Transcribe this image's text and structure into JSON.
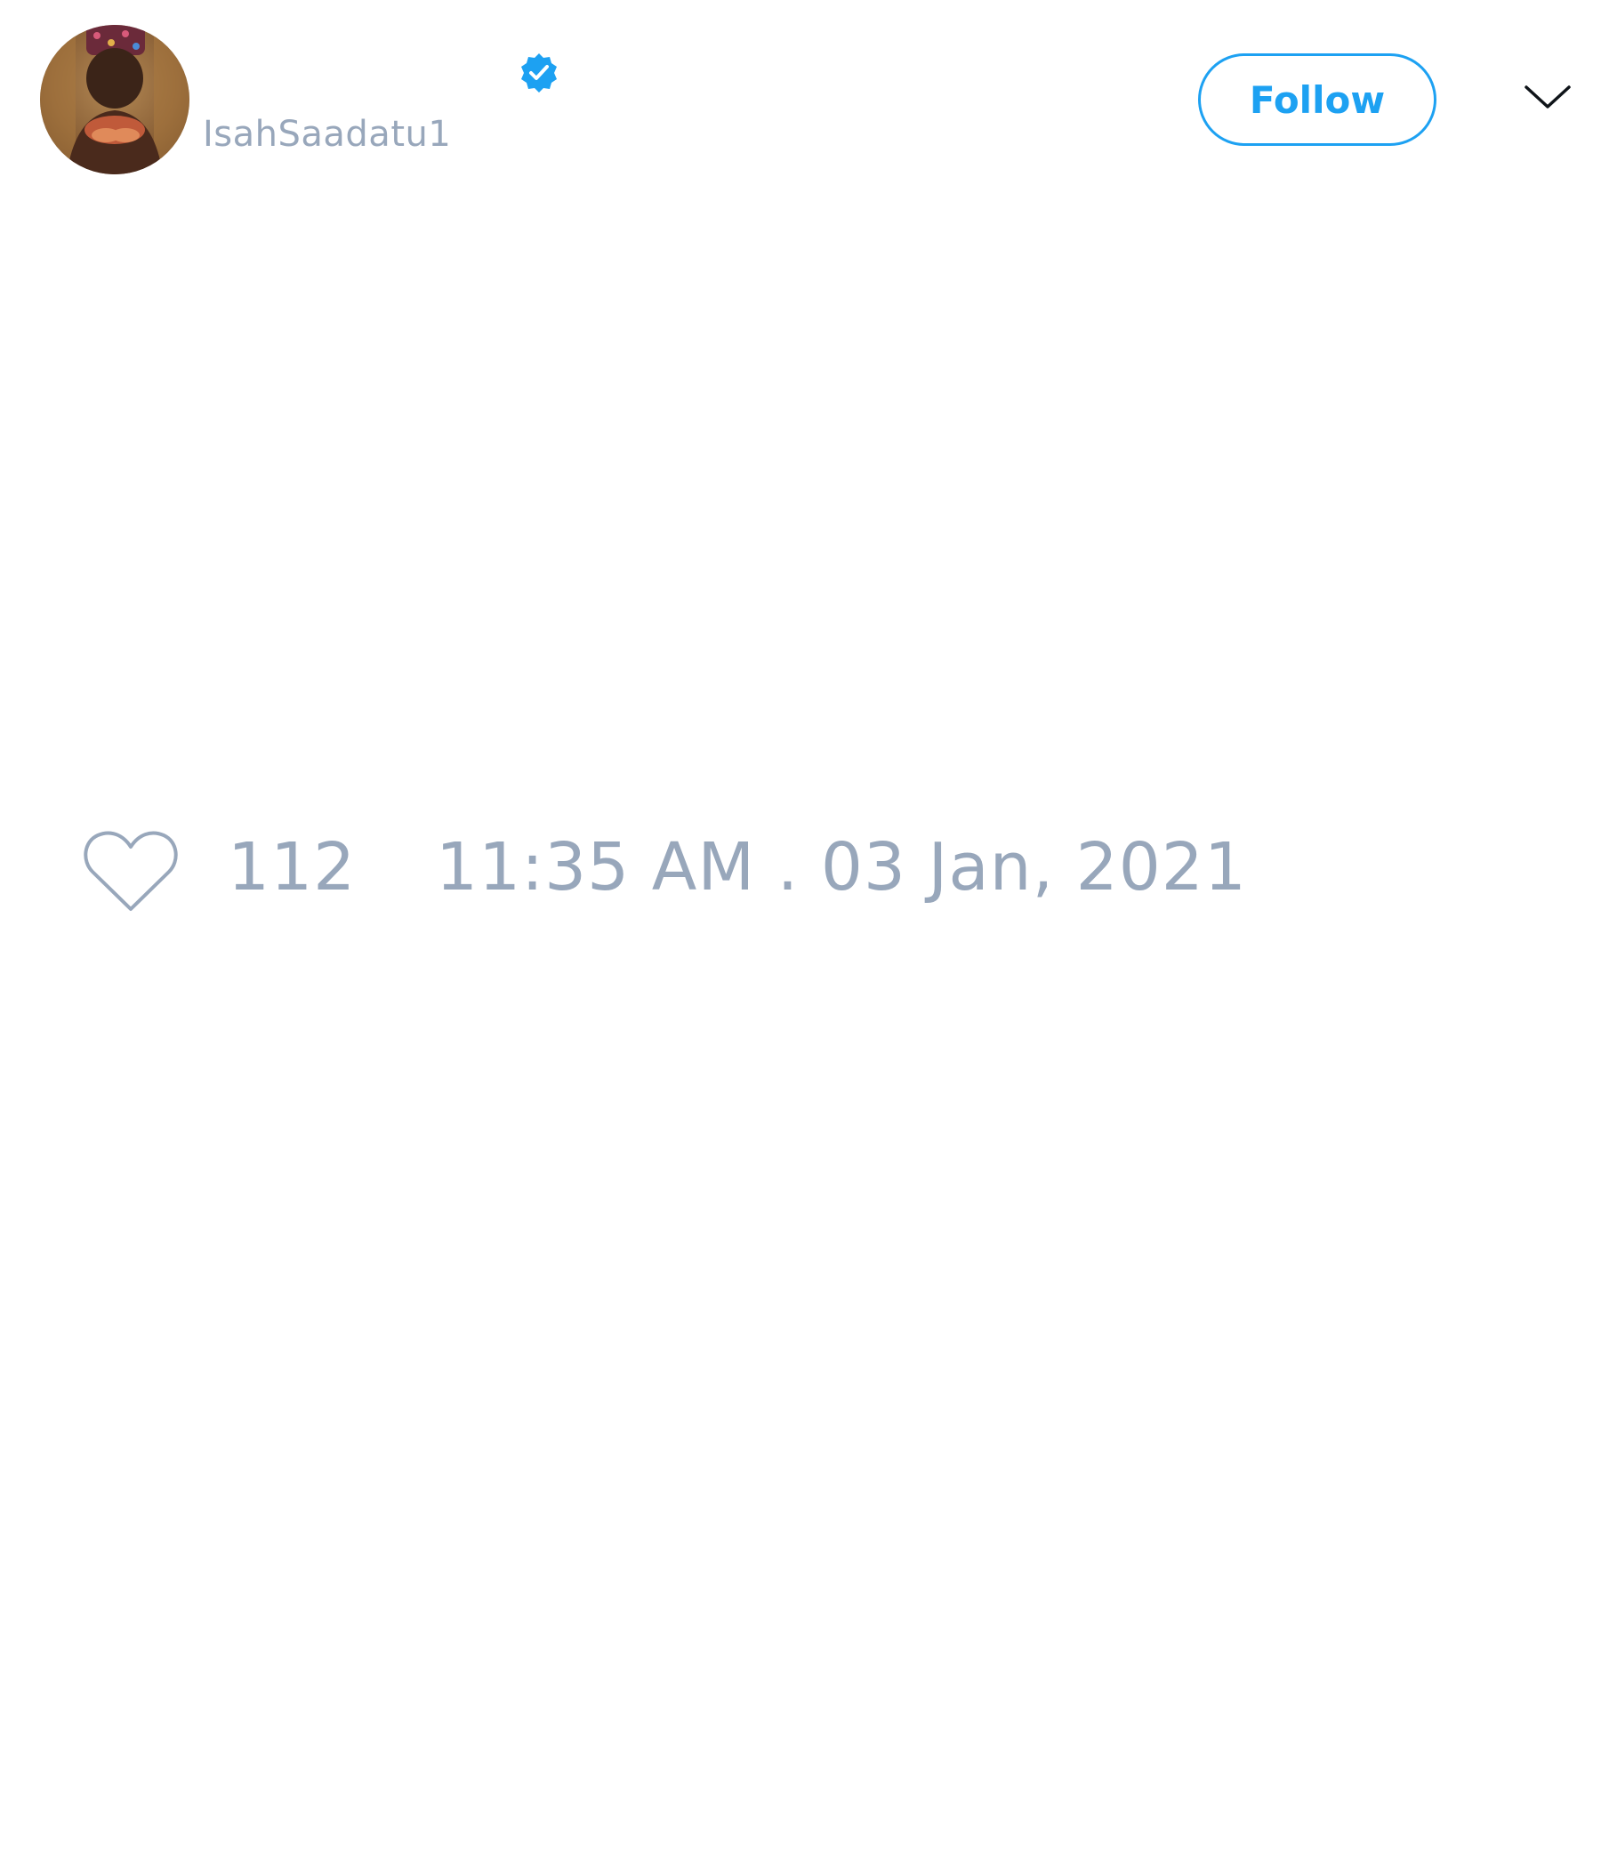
{
  "tweet": {
    "author": {
      "display_name": "",
      "handle": "IsahSaadatu1",
      "avatar_icon": "user-avatar-photo",
      "verified_icon": "verified-badge-icon"
    },
    "follow_label": "Follow",
    "menu_icon": "chevron-down-icon",
    "like_icon": "heart-outline-icon",
    "like_count": "112",
    "timestamp": "11:35 AM . 03 Jan, 2021"
  },
  "colors": {
    "accent": "#1da1f2",
    "muted_text": "#98a7bb",
    "background": "#ffffff",
    "icon_dark": "#0f1419"
  }
}
